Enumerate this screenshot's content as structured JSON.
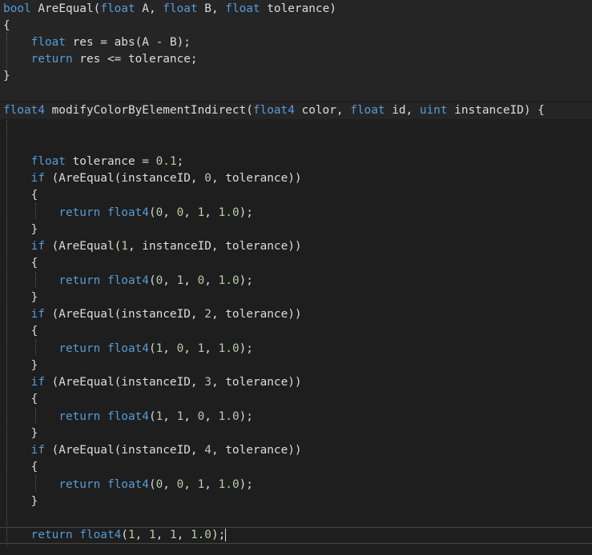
{
  "colors": {
    "background": "#1e1e1e",
    "function_band": "#252526",
    "keyword": "#569cd6",
    "number": "#b5cea8",
    "text": "#dcdcdc"
  },
  "code": {
    "lines": [
      [
        [
          "kw",
          "bool"
        ],
        [
          "pun",
          " "
        ],
        [
          "fn",
          "AreEqual"
        ],
        [
          "pun",
          "("
        ],
        [
          "kw",
          "float"
        ],
        [
          "pun",
          " A, "
        ],
        [
          "kw",
          "float"
        ],
        [
          "pun",
          " B, "
        ],
        [
          "kw",
          "float"
        ],
        [
          "pun",
          " tolerance)"
        ]
      ],
      [
        [
          "pun",
          "{"
        ]
      ],
      [
        [
          "pun",
          "    "
        ],
        [
          "kw",
          "float"
        ],
        [
          "pun",
          " res = abs(A - B);"
        ]
      ],
      [
        [
          "pun",
          "    "
        ],
        [
          "kw",
          "return"
        ],
        [
          "pun",
          " res <= tolerance;"
        ]
      ],
      [
        [
          "pun",
          "}"
        ]
      ],
      [],
      [
        [
          "kw",
          "float4"
        ],
        [
          "pun",
          " modifyColorByElementIndirect("
        ],
        [
          "kw",
          "float4"
        ],
        [
          "pun",
          " color, "
        ],
        [
          "kw",
          "float"
        ],
        [
          "pun",
          " id, "
        ],
        [
          "kw",
          "uint"
        ],
        [
          "pun",
          " instanceID) {"
        ]
      ],
      [],
      [],
      [
        [
          "pun",
          "    "
        ],
        [
          "kw",
          "float"
        ],
        [
          "pun",
          " tolerance = "
        ],
        [
          "num",
          "0.1"
        ],
        [
          "pun",
          ";"
        ]
      ],
      [
        [
          "pun",
          "    "
        ],
        [
          "kw",
          "if"
        ],
        [
          "pun",
          " (AreEqual(instanceID, "
        ],
        [
          "num",
          "0"
        ],
        [
          "pun",
          ", tolerance))"
        ]
      ],
      [
        [
          "pun",
          "    {"
        ]
      ],
      [
        [
          "pun",
          "        "
        ],
        [
          "kw",
          "return"
        ],
        [
          "pun",
          " "
        ],
        [
          "kw",
          "float4"
        ],
        [
          "pun",
          "("
        ],
        [
          "num",
          "0"
        ],
        [
          "pun",
          ", "
        ],
        [
          "num",
          "0"
        ],
        [
          "pun",
          ", "
        ],
        [
          "num",
          "1"
        ],
        [
          "pun",
          ", "
        ],
        [
          "num",
          "1.0"
        ],
        [
          "pun",
          ");"
        ]
      ],
      [
        [
          "pun",
          "    }"
        ]
      ],
      [
        [
          "pun",
          "    "
        ],
        [
          "kw",
          "if"
        ],
        [
          "pun",
          " (AreEqual("
        ],
        [
          "num",
          "1"
        ],
        [
          "pun",
          ", instanceID, tolerance))"
        ]
      ],
      [
        [
          "pun",
          "    {"
        ]
      ],
      [
        [
          "pun",
          "        "
        ],
        [
          "kw",
          "return"
        ],
        [
          "pun",
          " "
        ],
        [
          "kw",
          "float4"
        ],
        [
          "pun",
          "("
        ],
        [
          "num",
          "0"
        ],
        [
          "pun",
          ", "
        ],
        [
          "num",
          "1"
        ],
        [
          "pun",
          ", "
        ],
        [
          "num",
          "0"
        ],
        [
          "pun",
          ", "
        ],
        [
          "num",
          "1.0"
        ],
        [
          "pun",
          ");"
        ]
      ],
      [
        [
          "pun",
          "    }"
        ]
      ],
      [
        [
          "pun",
          "    "
        ],
        [
          "kw",
          "if"
        ],
        [
          "pun",
          " (AreEqual(instanceID, "
        ],
        [
          "num",
          "2"
        ],
        [
          "pun",
          ", tolerance))"
        ]
      ],
      [
        [
          "pun",
          "    {"
        ]
      ],
      [
        [
          "pun",
          "        "
        ],
        [
          "kw",
          "return"
        ],
        [
          "pun",
          " "
        ],
        [
          "kw",
          "float4"
        ],
        [
          "pun",
          "("
        ],
        [
          "num",
          "1"
        ],
        [
          "pun",
          ", "
        ],
        [
          "num",
          "0"
        ],
        [
          "pun",
          ", "
        ],
        [
          "num",
          "1"
        ],
        [
          "pun",
          ", "
        ],
        [
          "num",
          "1.0"
        ],
        [
          "pun",
          ");"
        ]
      ],
      [
        [
          "pun",
          "    }"
        ]
      ],
      [
        [
          "pun",
          "    "
        ],
        [
          "kw",
          "if"
        ],
        [
          "pun",
          " (AreEqual(instanceID, "
        ],
        [
          "num",
          "3"
        ],
        [
          "pun",
          ", tolerance))"
        ]
      ],
      [
        [
          "pun",
          "    {"
        ]
      ],
      [
        [
          "pun",
          "        "
        ],
        [
          "kw",
          "return"
        ],
        [
          "pun",
          " "
        ],
        [
          "kw",
          "float4"
        ],
        [
          "pun",
          "("
        ],
        [
          "num",
          "1"
        ],
        [
          "pun",
          ", "
        ],
        [
          "num",
          "1"
        ],
        [
          "pun",
          ", "
        ],
        [
          "num",
          "0"
        ],
        [
          "pun",
          ", "
        ],
        [
          "num",
          "1.0"
        ],
        [
          "pun",
          ");"
        ]
      ],
      [
        [
          "pun",
          "    }"
        ]
      ],
      [
        [
          "pun",
          "    "
        ],
        [
          "kw",
          "if"
        ],
        [
          "pun",
          " (AreEqual(instanceID, "
        ],
        [
          "num",
          "4"
        ],
        [
          "pun",
          ", tolerance))"
        ]
      ],
      [
        [
          "pun",
          "    {"
        ]
      ],
      [
        [
          "pun",
          "        "
        ],
        [
          "kw",
          "return"
        ],
        [
          "pun",
          " "
        ],
        [
          "kw",
          "float4"
        ],
        [
          "pun",
          "("
        ],
        [
          "num",
          "0"
        ],
        [
          "pun",
          ", "
        ],
        [
          "num",
          "0"
        ],
        [
          "pun",
          ", "
        ],
        [
          "num",
          "1"
        ],
        [
          "pun",
          ", "
        ],
        [
          "num",
          "1.0"
        ],
        [
          "pun",
          ");"
        ]
      ],
      [
        [
          "pun",
          "    }"
        ]
      ],
      [],
      [
        [
          "pun",
          "    "
        ],
        [
          "kw",
          "return"
        ],
        [
          "pun",
          " "
        ],
        [
          "kw",
          "float4"
        ],
        [
          "pun",
          "("
        ],
        [
          "num",
          "1"
        ],
        [
          "pun",
          ", "
        ],
        [
          "num",
          "1"
        ],
        [
          "pun",
          ", "
        ],
        [
          "num",
          "1"
        ],
        [
          "pun",
          ", "
        ],
        [
          "num",
          "1.0"
        ],
        [
          "pun",
          ");"
        ]
      ]
    ]
  }
}
